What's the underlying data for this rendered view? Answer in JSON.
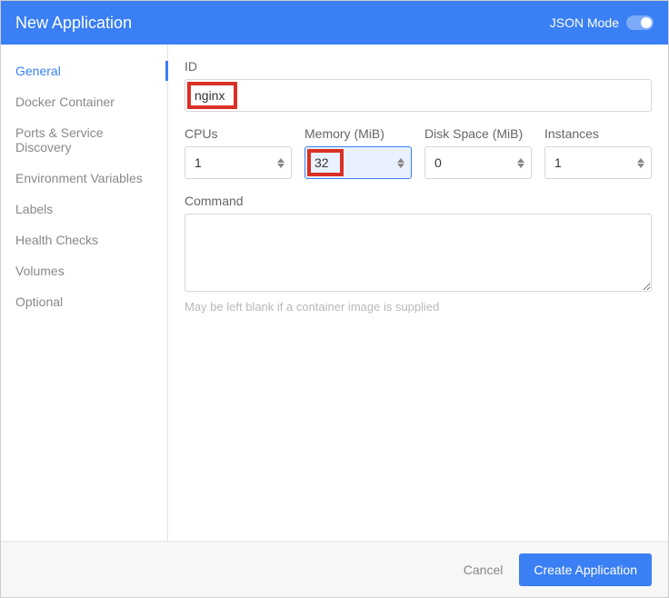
{
  "header": {
    "title": "New Application",
    "json_mode_label": "JSON Mode"
  },
  "sidebar": {
    "items": [
      {
        "label": "General",
        "active": true
      },
      {
        "label": "Docker Container",
        "active": false
      },
      {
        "label": "Ports & Service Discovery",
        "active": false
      },
      {
        "label": "Environment Variables",
        "active": false
      },
      {
        "label": "Labels",
        "active": false
      },
      {
        "label": "Health Checks",
        "active": false
      },
      {
        "label": "Volumes",
        "active": false
      },
      {
        "label": "Optional",
        "active": false
      }
    ]
  },
  "form": {
    "id_label": "ID",
    "id_value": "nginx",
    "cpus_label": "CPUs",
    "cpus_value": "1",
    "memory_label": "Memory (MiB)",
    "memory_value": "32",
    "disk_label": "Disk Space (MiB)",
    "disk_value": "0",
    "instances_label": "Instances",
    "instances_value": "1",
    "command_label": "Command",
    "command_value": "",
    "command_help": "May be left blank if a container image is supplied"
  },
  "footer": {
    "cancel": "Cancel",
    "create": "Create Application"
  }
}
